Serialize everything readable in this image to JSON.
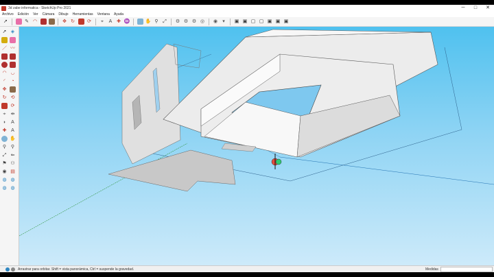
{
  "window": {
    "title": "3d zabe informatica - SketchUp Pro 2021",
    "minimize": "─",
    "maximize": "□",
    "close": "✕"
  },
  "menubar": [
    "Archivo",
    "Edición",
    "Ver",
    "Cámara",
    "Dibujo",
    "Herramientas",
    "Ventana",
    "Ayuda"
  ],
  "toolbar": [
    "select-tool",
    "eraser-tool",
    "line-tool",
    "arc-tool",
    "shapes-tool",
    "pushpull-tool",
    "move-tool",
    "rotate-tool",
    "scale-tool",
    "offset-tool",
    "tape-measure-tool",
    "text-tool",
    "axes-tool",
    "paint-bucket-tool",
    "orbit-tool",
    "pan-tool",
    "zoom-tool",
    "zoom-extents-tool",
    "warehouse-tool",
    "extension-warehouse-tool",
    "layout-tool",
    "styles-tool",
    "components-tool",
    "xray-tool",
    "back-edges-tool",
    "wireframe-tool",
    "hidden-line-tool",
    "shaded-tool",
    "shaded-textures-tool",
    "monochrome-tool"
  ],
  "left_toolbar": [
    "select",
    "component",
    "paint",
    "eraser",
    "line",
    "freehand",
    "rectangle",
    "rotated-rect",
    "circle",
    "polygon",
    "arc",
    "arc-2pt",
    "arc-3pt",
    "pie",
    "move",
    "pushpull",
    "rotate",
    "followme",
    "scale",
    "offset",
    "tape",
    "dimension",
    "protractor",
    "text",
    "axes",
    "3dtext",
    "orbit",
    "pan",
    "zoom",
    "zoom-window",
    "zoom-extents",
    "previous",
    "position-camera",
    "walk",
    "look-around",
    "section",
    "sandbox-1",
    "sandbox-2",
    "sandbox-3",
    "sandbox-4"
  ],
  "status": {
    "text": "Arrastrar para orbitar. Shift = vista panorámica, Ctrl = suspende la gravedad.",
    "measurements_label": "Medidas",
    "measurements_value": ""
  },
  "colors": {
    "sky_top": "#4fc1ef",
    "sky_bottom": "#cdeafa",
    "model_face": "#e6e6e6",
    "model_shade": "#c8c8c8",
    "axis_red": "#c0392b",
    "axis_green": "#27ae60"
  }
}
